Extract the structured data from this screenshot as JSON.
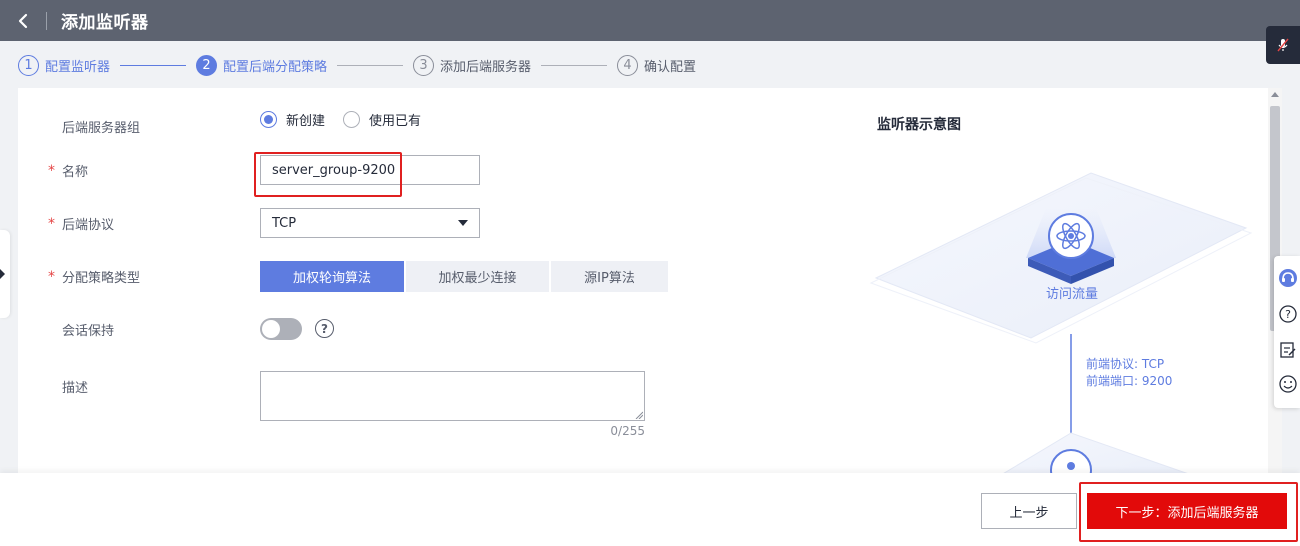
{
  "header": {
    "title": "添加监听器"
  },
  "steps": [
    {
      "num": "1",
      "label": "配置监听器",
      "state": "done"
    },
    {
      "num": "2",
      "label": "配置后端分配策略",
      "state": "active"
    },
    {
      "num": "3",
      "label": "添加后端服务器",
      "state": "todo"
    },
    {
      "num": "4",
      "label": "确认配置",
      "state": "todo"
    }
  ],
  "form": {
    "backend_group": {
      "label": "后端服务器组",
      "options": [
        "新创建",
        "使用已有"
      ],
      "selected": "新创建"
    },
    "name": {
      "label": "名称",
      "value": "server_group-9200"
    },
    "protocol": {
      "label": "后端协议",
      "value": "TCP"
    },
    "strategy": {
      "label": "分配策略类型",
      "options": [
        "加权轮询算法",
        "加权最少连接",
        "源IP算法"
      ],
      "selected": "加权轮询算法"
    },
    "session": {
      "label": "会话保持",
      "enabled": false
    },
    "description": {
      "label": "描述",
      "value": "",
      "counter": "0/255"
    },
    "required_mark": "*"
  },
  "diagram": {
    "title": "监听器示意图",
    "node_label": "访问流量",
    "frontend_protocol": "前端协议: TCP",
    "frontend_port": "前端端口: 9200"
  },
  "footer": {
    "prev_label": "上一步",
    "next_label": "下一步：添加后端服务器"
  },
  "colors": {
    "header_bg": "#5d6370",
    "accent": "#5e7ce0",
    "primary_red": "#e20a0a",
    "highlight_red": "#e02020"
  }
}
